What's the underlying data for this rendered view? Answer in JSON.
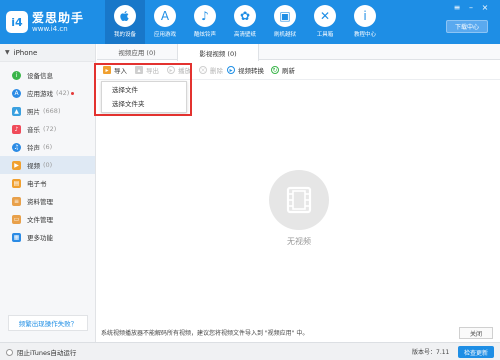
{
  "app": {
    "logo_text": "爱思助手",
    "logo_url": "www.i4.cn",
    "logo_badge": "i4"
  },
  "nav": {
    "items": [
      {
        "label": "我的设备",
        "icon": "apple-icon",
        "glyph": ""
      },
      {
        "label": "应用游戏",
        "icon": "app-store-icon",
        "glyph": "A"
      },
      {
        "label": "酷炫铃声",
        "icon": "bell-icon",
        "glyph": "♪"
      },
      {
        "label": "高清壁纸",
        "icon": "flower-icon",
        "glyph": "✿"
      },
      {
        "label": "刷机越狱",
        "icon": "box-icon",
        "glyph": "▣"
      },
      {
        "label": "工具箱",
        "icon": "tools-icon",
        "glyph": "✕"
      },
      {
        "label": "教程中心",
        "icon": "info-icon",
        "glyph": "i"
      }
    ],
    "download_label": "下载中心"
  },
  "sidebar": {
    "device": "iPhone",
    "items": [
      {
        "label": "设备信息",
        "count": "",
        "icon": "info-icon",
        "color": "#3ab54a",
        "glyph": "i"
      },
      {
        "label": "应用游戏",
        "count": "(42)",
        "icon": "app-icon",
        "color": "#2b8be5",
        "glyph": "A"
      },
      {
        "label": "照片",
        "count": "(668)",
        "icon": "photo-icon",
        "color": "#3aa0e0",
        "glyph": "▲"
      },
      {
        "label": "音乐",
        "count": "(72)",
        "icon": "music-icon",
        "color": "#f04b5a",
        "glyph": "♪"
      },
      {
        "label": "铃声",
        "count": "(6)",
        "icon": "bell-icon",
        "color": "#2b8be5",
        "glyph": "♫"
      },
      {
        "label": "视频",
        "count": "(0)",
        "icon": "video-icon",
        "color": "#f0a030",
        "glyph": "▶"
      },
      {
        "label": "电子书",
        "count": "",
        "icon": "book-icon",
        "color": "#f0a030",
        "glyph": "▤"
      },
      {
        "label": "资料管理",
        "count": "",
        "icon": "data-icon",
        "color": "#e8a04a",
        "glyph": "≡"
      },
      {
        "label": "文件管理",
        "count": "",
        "icon": "file-icon",
        "color": "#e8a04a",
        "glyph": "▭"
      },
      {
        "label": "更多功能",
        "count": "",
        "icon": "grid-icon",
        "color": "#2b8be5",
        "glyph": "▦"
      }
    ],
    "feedback": "频繁出现操作失败？"
  },
  "main": {
    "tabs": [
      "视频应用 (0)",
      "影视视频 (0)"
    ],
    "toolbar": {
      "import": "导入",
      "export": "导出",
      "play": "播放",
      "delete": "删除",
      "convert": "视频转换",
      "refresh": "刷新"
    },
    "dropdown": [
      "选择文件",
      "选择文件夹"
    ],
    "empty_label": "无视频",
    "notice": "系统视频播放器不能解码所有视频，建议您将视频文件导入到 \"视频应用\" 中。",
    "close_label": "关闭"
  },
  "status": {
    "stop_itunes": "阻止iTunes自动运行",
    "version": "版本号：7.11",
    "update": "检查更新"
  },
  "colors": {
    "brand": "#1e8ee5",
    "highlight": "#e3322f"
  }
}
